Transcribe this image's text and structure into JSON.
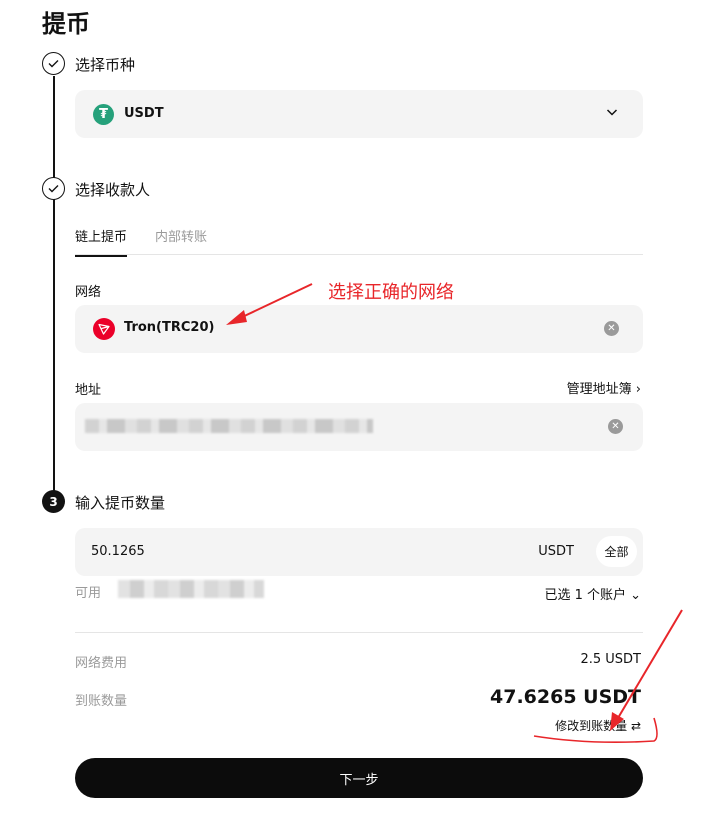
{
  "page_title": "提币",
  "steps": {
    "step1_label": "选择币种",
    "step2_label": "选择收款人",
    "step3_label": "输入提币数量",
    "step3_number": "3"
  },
  "coin": {
    "icon_glyph": "₮",
    "name": "USDT",
    "icon_color": "#26a17b"
  },
  "tabs": {
    "onchain": "链上提币",
    "internal": "内部转账"
  },
  "network": {
    "label": "网络",
    "value": "Tron(TRC20)",
    "icon_color": "#eb0029"
  },
  "address": {
    "label": "地址",
    "book_link": "管理地址簿 ›"
  },
  "amount": {
    "value": "50.1265",
    "unit": "USDT",
    "all_label": "全部",
    "available_label": "可用",
    "account_select": "已选 1 个账户 ⌄"
  },
  "summary": {
    "fee_label": "网络费用",
    "fee_value": "2.5 USDT",
    "receive_label": "到账数量",
    "receive_value": "47.6265 USDT",
    "modify_link": "修改到账数量 ⇄"
  },
  "next_button": "下一步",
  "annotation": {
    "text": "选择正确的网络",
    "color": "#e8262a"
  }
}
